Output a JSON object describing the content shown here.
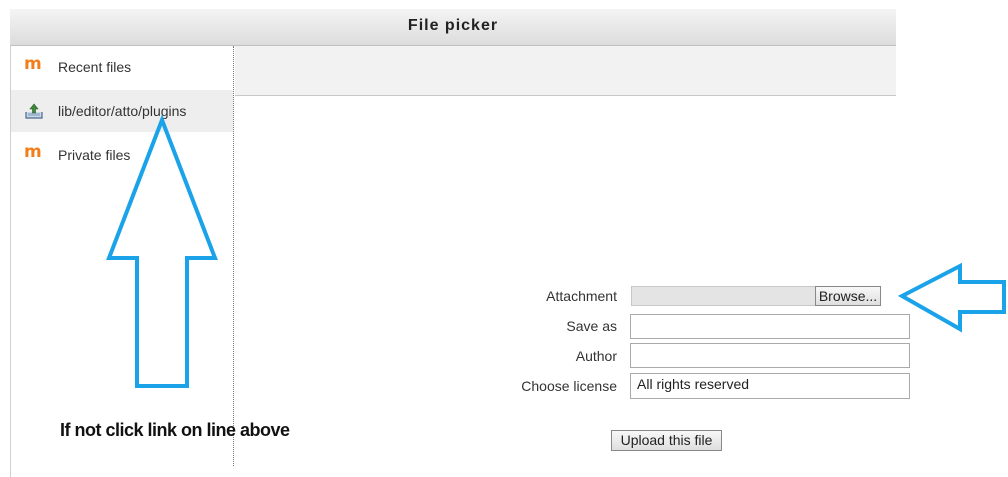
{
  "window": {
    "title": "File picker"
  },
  "sidebar": {
    "items": [
      {
        "label": "Recent files",
        "icon": "moodle-icon"
      },
      {
        "label": "lib/editor/atto/plugins",
        "icon": "upload-tray-icon",
        "active": true
      },
      {
        "label": "Private files",
        "icon": "moodle-icon"
      }
    ]
  },
  "upload_form": {
    "attachment_label": "Attachment",
    "browse_label": "Browse...",
    "save_as_label": "Save as",
    "save_as_value": "",
    "author_label": "Author",
    "author_value": "",
    "license_label": "Choose license",
    "license_value": "All rights reserved",
    "upload_label": "Upload this file"
  },
  "annotation": {
    "caption": "If not click link on line above",
    "arrow_color": "#1aa3e8"
  },
  "colors": {
    "moodle_orange": "#f27e1b",
    "arrow_blue": "#1aa3e8"
  }
}
